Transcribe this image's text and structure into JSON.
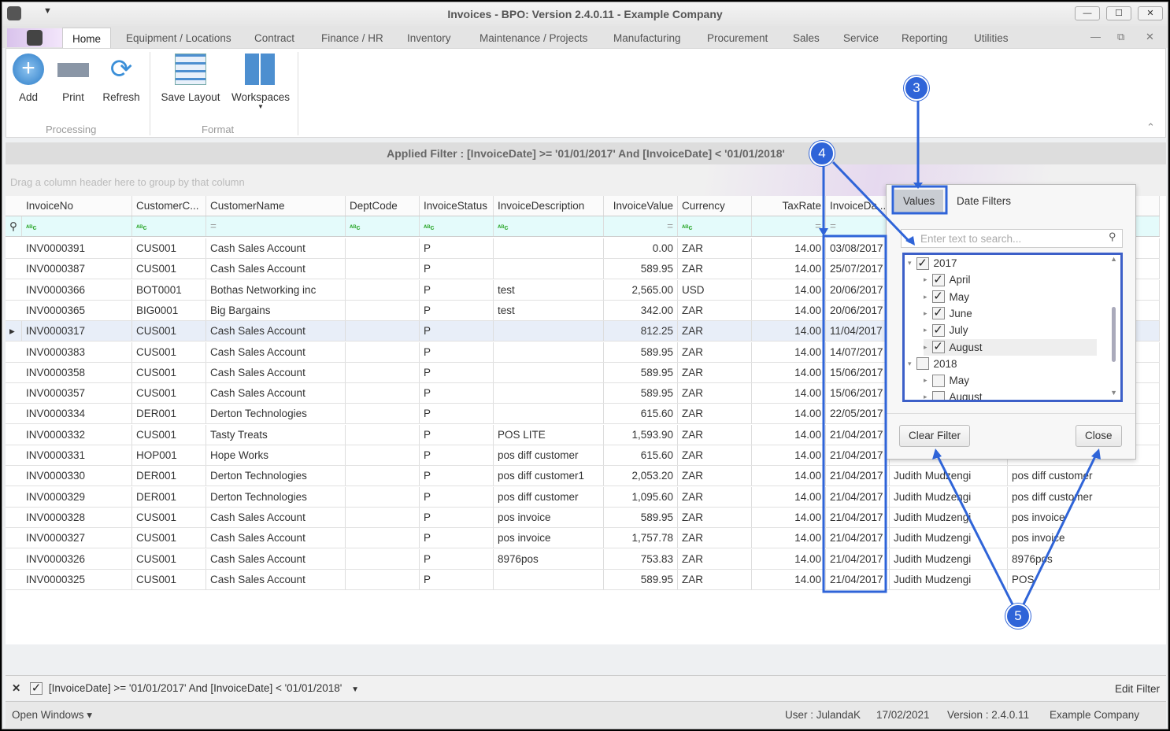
{
  "window": {
    "title": "Invoices - BPO: Version 2.4.0.11 - Example Company",
    "min": "—",
    "max": "☐",
    "close": "✕"
  },
  "tabs": [
    "Home",
    "Equipment / Locations",
    "Contract",
    "Finance / HR",
    "Inventory",
    "Maintenance / Projects",
    "Manufacturing",
    "Procurement",
    "Sales",
    "Service",
    "Reporting",
    "Utilities"
  ],
  "ribbon": {
    "add": "Add",
    "print": "Print",
    "refresh": "Refresh",
    "save_layout": "Save Layout",
    "workspaces": "Workspaces",
    "group_processing": "Processing",
    "group_format": "Format"
  },
  "applied_filter": "Applied Filter : [InvoiceDate] >= '01/01/2017' And [InvoiceDate] < '01/01/2018'",
  "group_panel": "Drag a column header here to group by that column",
  "columns": [
    "InvoiceNo",
    "CustomerC...",
    "CustomerName",
    "DeptCode",
    "InvoiceStatus",
    "InvoiceDescription",
    "InvoiceValue",
    "Currency",
    "TaxRate",
    "InvoiceDa..."
  ],
  "rows": [
    [
      "INV0000391",
      "CUS001",
      "Cash Sales Account",
      "",
      "P",
      "",
      "0.00",
      "ZAR",
      "14.00",
      "03/08/2017",
      "",
      ""
    ],
    [
      "INV0000387",
      "CUS001",
      "Cash Sales Account",
      "",
      "P",
      "",
      "589.95",
      "ZAR",
      "14.00",
      "25/07/2017",
      "",
      ""
    ],
    [
      "INV0000366",
      "BOT0001",
      "Bothas Networking inc",
      "",
      "P",
      "test",
      "2,565.00",
      "USD",
      "14.00",
      "20/06/2017",
      "",
      ""
    ],
    [
      "INV0000365",
      "BIG0001",
      "Big Bargains",
      "",
      "P",
      "test",
      "342.00",
      "ZAR",
      "14.00",
      "20/06/2017",
      "",
      ""
    ],
    [
      "INV0000317",
      "CUS001",
      "Cash Sales Account",
      "",
      "P",
      "",
      "812.25",
      "ZAR",
      "14.00",
      "11/04/2017",
      "",
      ""
    ],
    [
      "INV0000383",
      "CUS001",
      "Cash Sales Account",
      "",
      "P",
      "",
      "589.95",
      "ZAR",
      "14.00",
      "14/07/2017",
      "",
      ""
    ],
    [
      "INV0000358",
      "CUS001",
      "Cash Sales Account",
      "",
      "P",
      "",
      "589.95",
      "ZAR",
      "14.00",
      "15/06/2017",
      "",
      ""
    ],
    [
      "INV0000357",
      "CUS001",
      "Cash Sales Account",
      "",
      "P",
      "",
      "589.95",
      "ZAR",
      "14.00",
      "15/06/2017",
      "",
      ""
    ],
    [
      "INV0000334",
      "DER001",
      "Derton Technologies",
      "",
      "P",
      "",
      "615.60",
      "ZAR",
      "14.00",
      "22/05/2017",
      "",
      ""
    ],
    [
      "INV0000332",
      "CUS001",
      "Tasty Treats",
      "",
      "P",
      "POS LITE",
      "1,593.90",
      "ZAR",
      "14.00",
      "21/04/2017",
      "",
      ""
    ],
    [
      "INV0000331",
      "HOP001",
      "Hope Works",
      "",
      "P",
      "pos diff customer",
      "615.60",
      "ZAR",
      "14.00",
      "21/04/2017",
      "",
      ""
    ],
    [
      "INV0000330",
      "DER001",
      "Derton Technologies",
      "",
      "P",
      "pos diff customer1",
      "2,053.20",
      "ZAR",
      "14.00",
      "21/04/2017",
      "Judith Mudzengi",
      "pos diff customer"
    ],
    [
      "INV0000329",
      "DER001",
      "Derton Technologies",
      "",
      "P",
      "pos diff customer",
      "1,095.60",
      "ZAR",
      "14.00",
      "21/04/2017",
      "Judith Mudzengi",
      "pos diff customer"
    ],
    [
      "INV0000328",
      "CUS001",
      "Cash Sales Account",
      "",
      "P",
      "pos invoice",
      "589.95",
      "ZAR",
      "14.00",
      "21/04/2017",
      "Judith Mudzengi",
      "pos invoice"
    ],
    [
      "INV0000327",
      "CUS001",
      "Cash Sales Account",
      "",
      "P",
      "pos invoice",
      "1,757.78",
      "ZAR",
      "14.00",
      "21/04/2017",
      "Judith Mudzengi",
      "pos invoice"
    ],
    [
      "INV0000326",
      "CUS001",
      "Cash Sales Account",
      "",
      "P",
      "8976pos",
      "753.83",
      "ZAR",
      "14.00",
      "21/04/2017",
      "Judith Mudzengi",
      "8976pos"
    ],
    [
      "INV0000325",
      "CUS001",
      "Cash Sales Account",
      "",
      "P",
      "",
      "589.95",
      "ZAR",
      "14.00",
      "21/04/2017",
      "Judith Mudzengi",
      "POS"
    ]
  ],
  "filter_popup": {
    "tab_values": "Values",
    "tab_date_filters": "Date Filters",
    "search_placeholder": "Enter text to search...",
    "tree": [
      {
        "label": "2017",
        "level": 0,
        "checked": true
      },
      {
        "label": "April",
        "level": 1,
        "checked": true
      },
      {
        "label": "May",
        "level": 1,
        "checked": true
      },
      {
        "label": "June",
        "level": 1,
        "checked": true
      },
      {
        "label": "July",
        "level": 1,
        "checked": true
      },
      {
        "label": "August",
        "level": 1,
        "checked": true
      },
      {
        "label": "2018",
        "level": 0,
        "checked": false
      },
      {
        "label": "May",
        "level": 1,
        "checked": false
      },
      {
        "label": "August",
        "level": 1,
        "checked": false
      }
    ],
    "clear_filter": "Clear Filter",
    "close": "Close"
  },
  "filter_status": {
    "expression": "[InvoiceDate] >= '01/01/2017' And [InvoiceDate] < '01/01/2018'",
    "edit_filter": "Edit Filter"
  },
  "status": {
    "open_windows": "Open Windows",
    "user": "User : JulandaK",
    "date": "17/02/2021",
    "version": "Version : 2.4.0.11",
    "company": "Example Company"
  },
  "annotations": [
    "3",
    "4",
    "5"
  ],
  "colors": {
    "annotation": "#2f64d8"
  }
}
